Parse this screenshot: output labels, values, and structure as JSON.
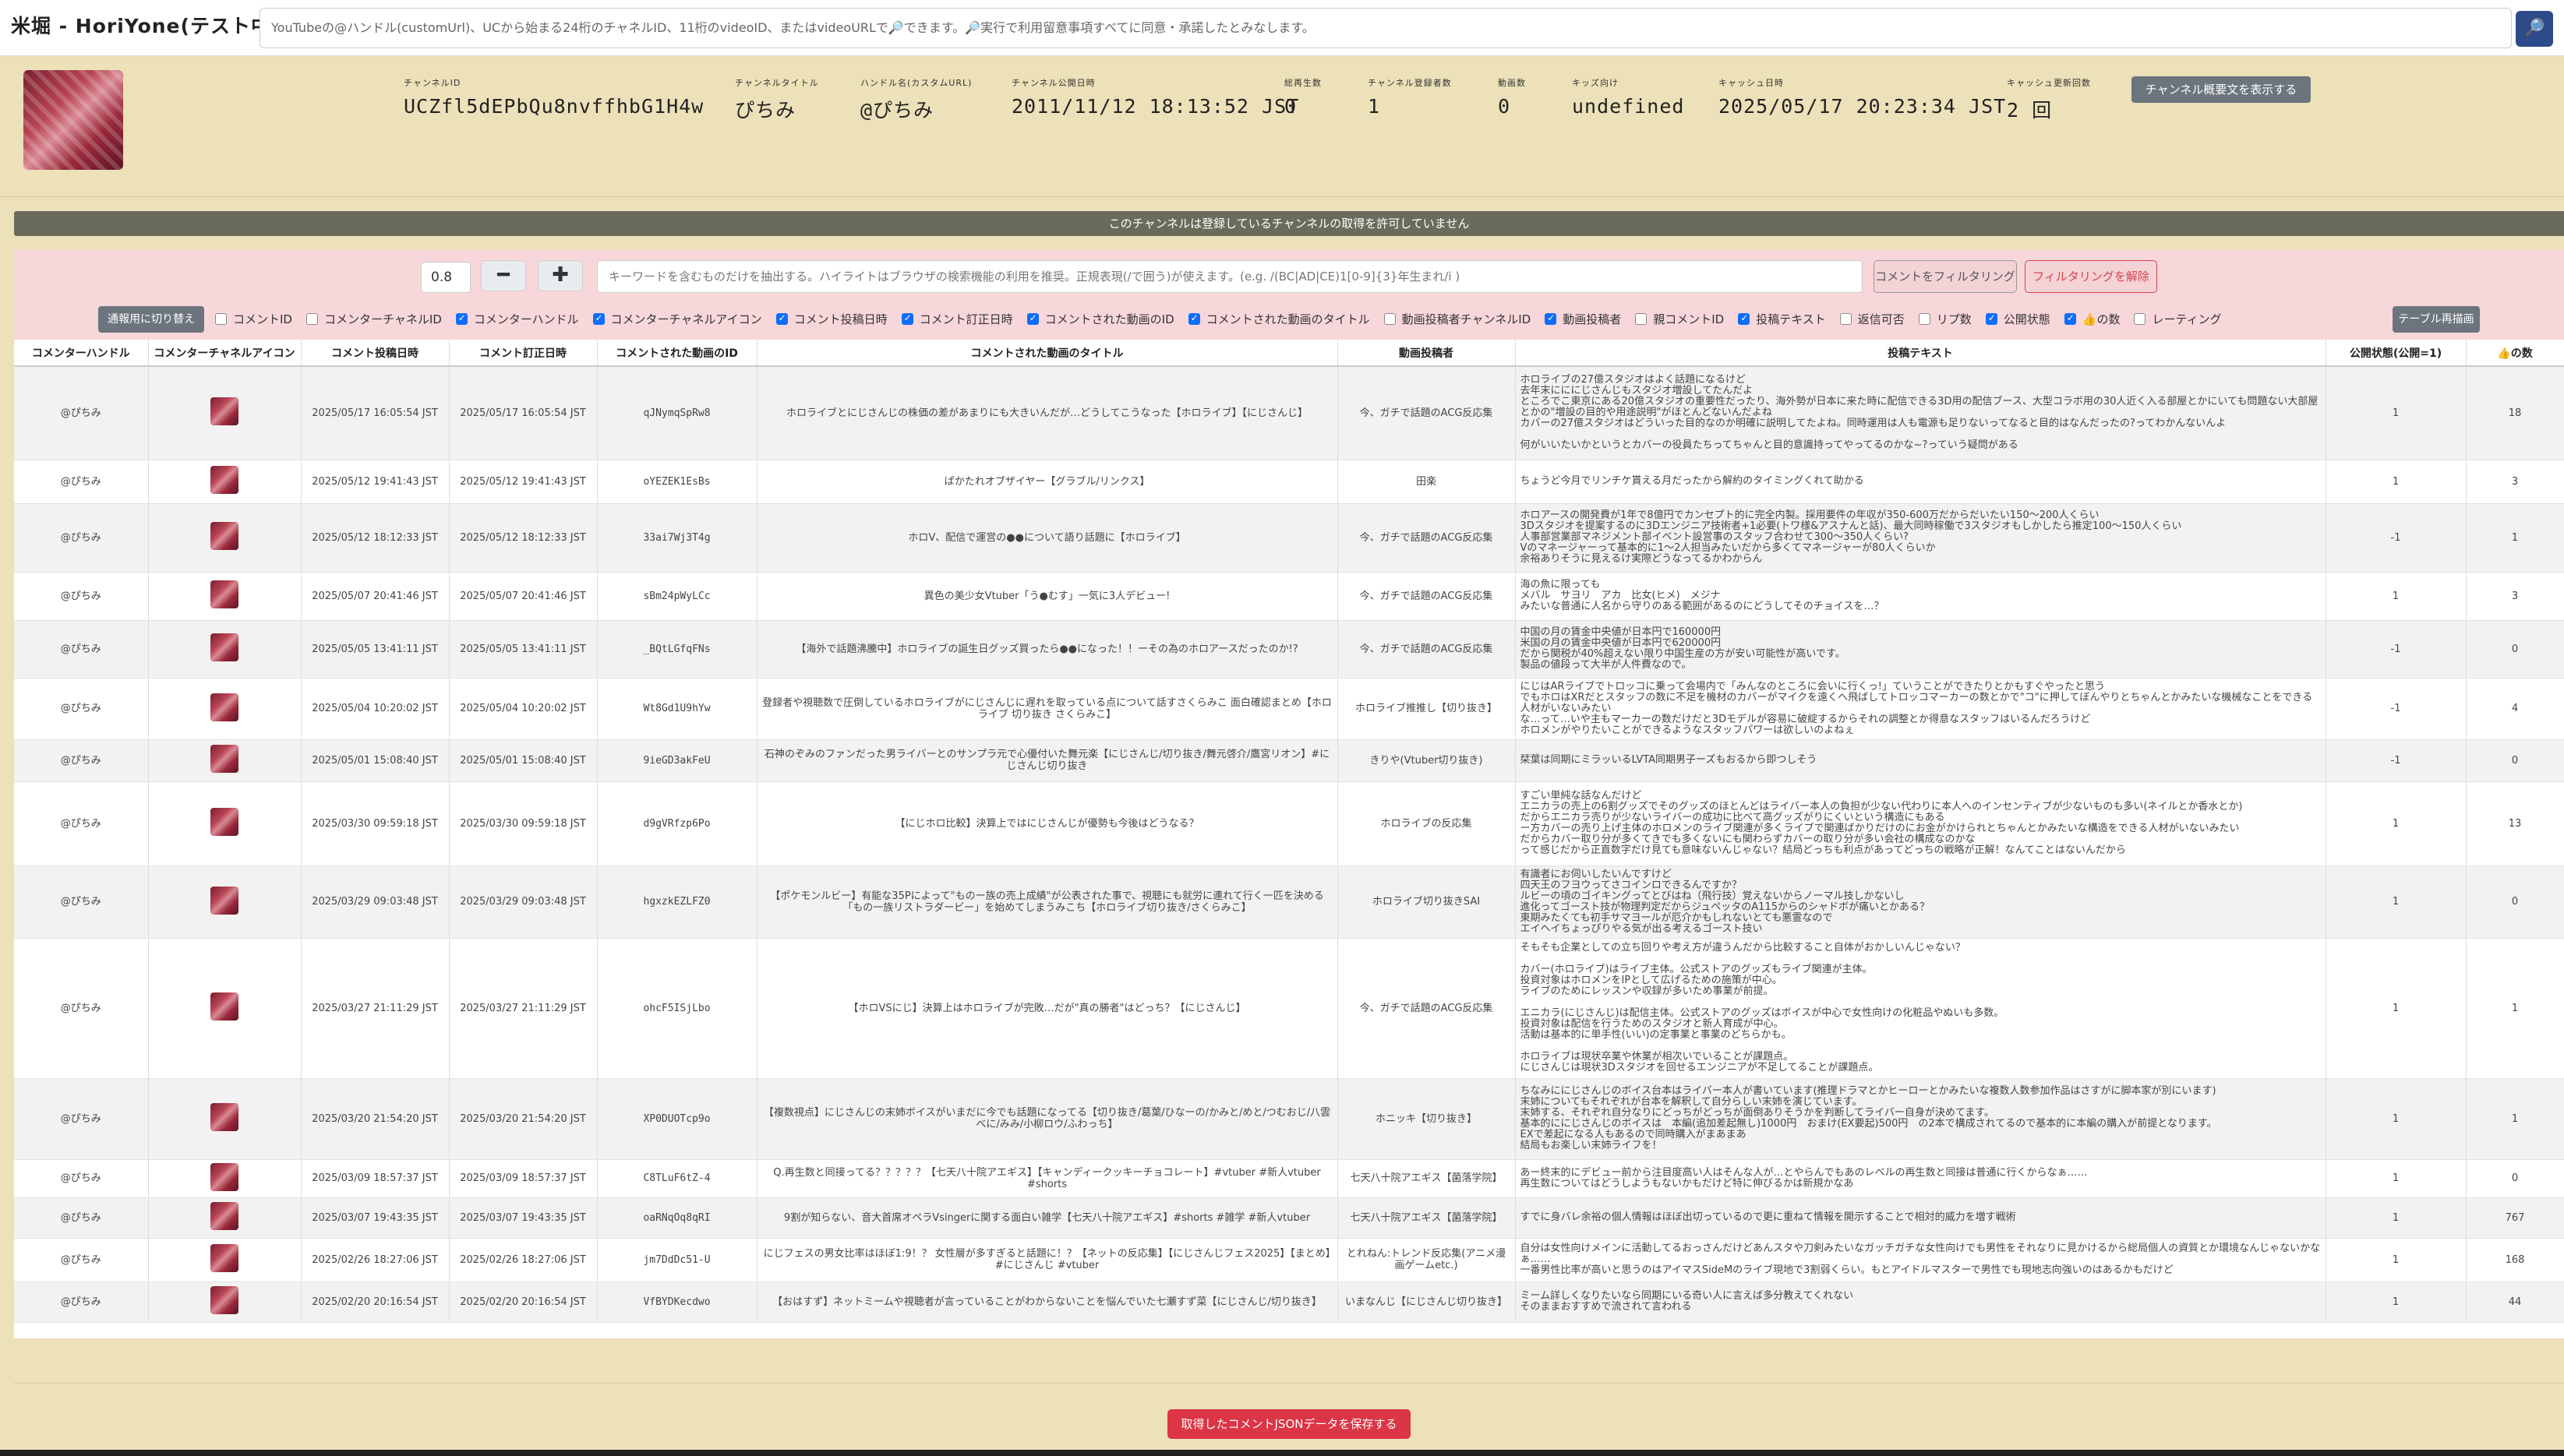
{
  "app": {
    "title": "米堀 - HoriYone(テスト中)"
  },
  "search": {
    "placeholder": "YouTubeの@ハンドル(customUrl)、UCから始まる24桁のチャネルID、11桁のvideoID、またはvideoURLで🔎できます。🔎実行で利用留意事項すべてに同意・承諾したとみなします。",
    "button_icon": "🔎"
  },
  "channel": {
    "fields": [
      {
        "label": "チャンネルID",
        "value": "UCZfl5dEPbQu8nvffhbG1H4w"
      },
      {
        "label": "チャンネルタイトル",
        "value": "ぴちみ"
      },
      {
        "label": "ハンドル名(カスタムURL)",
        "value": "@ぴちみ"
      },
      {
        "label": "チャンネル公開日時",
        "value": "2011/11/12 18:13:52 JST"
      },
      {
        "label": "総再生数",
        "value": "0"
      },
      {
        "label": "チャンネル登録者数",
        "value": "1"
      },
      {
        "label": "動画数",
        "value": "0"
      },
      {
        "label": "キッズ向け",
        "value": "undefined"
      },
      {
        "label": "キャッシュ日時",
        "value": "2025/05/17 20:23:34 JST"
      },
      {
        "label": "キャッシュ更新回数",
        "value": "2 回"
      }
    ],
    "show_description_label": "チャンネル概要文を表示する",
    "notice": "このチャンネルは登録しているチャンネルの取得を許可していません"
  },
  "filter": {
    "step_value": "0.8",
    "minus_label": "━",
    "plus_label": "✚",
    "keyword_placeholder": "キーワードを含むものだけを抽出する。ハイライトはブラウザの検索機能の利用を推奨。正規表現(/で囲う)が使えます。(e.g. /(BC|AD|CE)1[0-9]{3}年生まれ/i )",
    "filter_button": "コメントをフィルタリング",
    "unfilter_button": "フィルタリングを解除",
    "switch_button": "通報用に切り替え",
    "redraw_button": "テーブル再描画",
    "columns": [
      {
        "label": "コメントID",
        "checked": false
      },
      {
        "label": "コメンターチャネルID",
        "checked": false
      },
      {
        "label": "コメンターハンドル",
        "checked": true
      },
      {
        "label": "コメンターチャネルアイコン",
        "checked": true
      },
      {
        "label": "コメント投稿日時",
        "checked": true
      },
      {
        "label": "コメント訂正日時",
        "checked": true
      },
      {
        "label": "コメントされた動画のID",
        "checked": true
      },
      {
        "label": "コメントされた動画のタイトル",
        "checked": true
      },
      {
        "label": "動画投稿者チャンネルID",
        "checked": false
      },
      {
        "label": "動画投稿者",
        "checked": true
      },
      {
        "label": "親コメントID",
        "checked": false
      },
      {
        "label": "投稿テキスト",
        "checked": true
      },
      {
        "label": "返信可否",
        "checked": false
      },
      {
        "label": "リプ数",
        "checked": false
      },
      {
        "label": "公開状態",
        "checked": true
      },
      {
        "label": "👍の数",
        "checked": true
      },
      {
        "label": "レーティング",
        "checked": false
      }
    ]
  },
  "table": {
    "headers": [
      "コメンターハンドル",
      "コメンターチャネルアイコン",
      "コメント投稿日時",
      "コメント訂正日時",
      "コメントされた動画のID",
      "コメントされた動画のタイトル",
      "動画投稿者",
      "投稿テキスト",
      "公開状態(公開=1)",
      "👍の数"
    ],
    "rows": [
      {
        "handle": "@ぴちみ",
        "posted": "2025/05/17 16:05:54 JST",
        "edited": "2025/05/17 16:05:54 JST",
        "video_id": "qJNymqSpRw8",
        "title": "ホロライブとにじさんじの株価の差があまりにも大きいんだが…どうしてこうなった【ホロライブ】【にじさんじ】",
        "uploader": "今、ガチで話題のACG反応集",
        "text": "ホロライブの27億スタジオはよく話題になるけど\n去年末にににじさんじもスタジオ増設してたんだよ\nところでこ東京にある20億スタジオの重要性だったり、海外勢が日本に来た時に配信できる3D用の配信ブース、大型コラボ用の30人近く入る部屋とかにいても問題ない大部屋とかの\"増設の目的や用途説明\"がほとんどないんだよね\nカバーの27億スタジオはどういった目的なのか明確に説明してたよね。同時運用は人も電源も足りないってなると目的はなんだったの?ってわかんないんよ\n\n何がいいたいかというとカバーの役員たちってちゃんと目的意識持ってやってるのかな~?っていう疑問がある",
        "status": "1",
        "likes": "18",
        "h": 120
      },
      {
        "handle": "@ぴちみ",
        "posted": "2025/05/12 19:41:43 JST",
        "edited": "2025/05/12 19:41:43 JST",
        "video_id": "oYEZEK1EsBs",
        "title": "ぱかたれオブザイヤー【グラブル/リンクス】",
        "uploader": "田楽",
        "text": "ちょうど今月でリンチケ貰える月だったから解約のタイミングくれて助かる",
        "status": "1",
        "likes": "3",
        "h": 56
      },
      {
        "handle": "@ぴちみ",
        "posted": "2025/05/12 18:12:33 JST",
        "edited": "2025/05/12 18:12:33 JST",
        "video_id": "33ai7Wj3T4g",
        "title": "ホロV、配信で運営の●●について語り話題に【ホロライブ】",
        "uploader": "今、ガチで話題のACG反応集",
        "text": "ホロアースの開発費が1年で8億円でカンセプト的に完全内製。採用要件の年収が350-600万だからだいたい150～200人くらい\n3Dスタジオを提案するのに3Dエンジニア技術者+1必要(トワ様&アスナんと話)、最大同時稼働で3スタジオもしかしたら推定100～150人くらい\n人事部営業部マネジメント部イベント設営事のスタッフ合わせて300～350人くらい?\nVのマネージャーって基本的に1～2人担当みたいだから多くてマネージャーが80人くらいか\n余裕ありそうに見えるけ実際どうなってるかわからん",
        "status": "-1",
        "likes": "1",
        "h": 88
      },
      {
        "handle": "@ぴちみ",
        "posted": "2025/05/07 20:41:46 JST",
        "edited": "2025/05/07 20:41:46 JST",
        "video_id": "sBm24pWyLCc",
        "title": "異色の美少女Vtuber「う●むす」一気に3人デビュー!",
        "uploader": "今、ガチで話題のACG反応集",
        "text": "海の魚に限っても\nメバル　サヨリ　アカ　比女(ヒメ)　メジナ\nみたいな普通に人名から守りのある範囲があるのにどうしてそのチョイスを…？",
        "status": "1",
        "likes": "3",
        "h": 62
      },
      {
        "handle": "@ぴちみ",
        "posted": "2025/05/05 13:41:11 JST",
        "edited": "2025/05/05 13:41:11 JST",
        "video_id": "_BQtLGfqFNs",
        "title": "【海外で話題沸騰中】ホロライブの誕生日グッズ買ったら●●になった！！ーその為のホロアースだったのか!?",
        "uploader": "今、ガチで話題のACG反応集",
        "text": "中国の月の賃金中央値が日本円で160000円\n米国の月の賃金中央値が日本円で620000円\nだから関税が40%超えない限り中国生産の方が安い可能性が高いです。\n製品の値段って大半が人件費なので。",
        "status": "-1",
        "likes": "0",
        "h": 74
      },
      {
        "handle": "@ぴちみ",
        "posted": "2025/05/04 10:20:02 JST",
        "edited": "2025/05/04 10:20:02 JST",
        "video_id": "Wt8Gd1U9hYw",
        "title": "登録者や視聴数で圧倒しているホロライブがにじさんじに遅れを取っている点について話すさくらみこ 面白確認まとめ【ホロライブ 切り抜き さくらみこ】",
        "uploader": "ホロライブ推推し【切り抜き】",
        "text": "にじはARライブでトロッコに乗って会場内で「みんなのところに会いに行くっ!」ていうことができたりとかもすぐやったと思う\nでもホロはXRだとスタッフの数に不足を機材のカバーがマイクを遠くへ飛ばしてトロッコマーカーの数とかで\"コ\"に押してぼんやりとちゃんとかみたいな機械なことをできる人材がいないみたい\nな…って…いや主もマーカーの数だけだと3Dモデルが容易に破綻するからそれの調整とか得意なスタッフはいるんだろうけど\nホロメンがやりたいことができるようなスタッフパワーは欲しいのよねぇ",
        "status": "-1",
        "likes": "4",
        "h": 76
      },
      {
        "handle": "@ぴちみ",
        "posted": "2025/05/01 15:08:40 JST",
        "edited": "2025/05/01 15:08:40 JST",
        "video_id": "9ieGD3akFeU",
        "title": "石神のぞみのファンだった男ライバーとのサンプラ元で心優付いた舞元楽【にじさんじ/切り抜き/舞元啓介/鷹宮リオン】#にじさんじ切り抜き",
        "uploader": "きりや(Vtuber切り抜き)",
        "text": "栞葉は同期にミラッいるLVTA同期男子ーズもおるから即つしそう",
        "status": "-1",
        "likes": "0",
        "h": 54
      },
      {
        "handle": "@ぴちみ",
        "posted": "2025/03/30 09:59:18 JST",
        "edited": "2025/03/30 09:59:18 JST",
        "video_id": "d9gVRfzp6Po",
        "title": "【にじホロ比較】決算上ではにじさんじが優勢も今後はどうなる？",
        "uploader": "ホロライブの反応集",
        "text": "すごい単純な話なんだけど\nエニカラの売上の6割グッズでそのグッズのほとんどはライバー本人の負担が少ない代わりに本人へのインセンティブが少ないものも多い(ネイルとか香水とか)\nだからエニカラ売りが少ないライバーの成功に比べて高グッズがりにくいという構造にもある\nー方カバーの売り上げ主体のホロメンのライブ関連が多くライブで関連ばかりだけのにお金がかけられとちゃんとかみたいな構造をできる人材がいないみたい\nだからカバー取り分が多くてきでも多くないにも関わらずカバーの取り分が多い会社の構成なのかな\nって感じだから正直数字だけ見ても意味ないんじゃない？結局どっちも利点があってどっちの戦略が正解！なんてことはないんだから",
        "status": "1",
        "likes": "13",
        "h": 108
      },
      {
        "handle": "@ぴちみ",
        "posted": "2025/03/29 09:03:48 JST",
        "edited": "2025/03/29 09:03:48 JST",
        "video_id": "hgxzkEZLFZ0",
        "title": "【ポケモンルビー】有能な35Pによって\"ものー族の売上成績\"が公表された事で、視聴にも就労に連れて行く一匹を決める「もの一族リストラダービー」を始めてしまうみこち【ホロライブ切り抜き/さくらみこ】",
        "uploader": "ホロライブ切り抜きSAI",
        "text": "有識者にお伺いしたいんですけど\n四天王のフヨウってさコインロできるんですか？\nルビーの頃のゴイキングってとびはね（飛行技）覚えないからノーマル技しかないし\n進化ってゴースト技が物理判定だからジュペッタのA115からのシャドボが痛いとかある？\n東期みたくても初手サマヨールが厄介かもしれないとても悪霊なので\nエイヘイちょっぴりやる気が出る考えるゴースト技い",
        "status": "1",
        "likes": "0",
        "h": 86
      },
      {
        "handle": "@ぴちみ",
        "posted": "2025/03/27 21:11:29 JST",
        "edited": "2025/03/27 21:11:29 JST",
        "video_id": "ohcF5ISjLbo",
        "title": "【ホロVSにじ】決算上はホロライブが完敗…だが\"真の勝者\"はどっち？【にじさんじ】",
        "uploader": "今、ガチで話題のACG反応集",
        "text": "そもそも企業としての立ち回りや考え方が違うんだから比較すること自体がおかしいんじゃない？\n\nカバー(ホロライブ)はライブ主体。公式ストアのグッズもライブ関連が主体。\n投資対象はホロメンをIPとして広げるための施策が中心。\nライブのためにレッスンや収録が多いため事業が前提。\n\nエニカラ(にじさんじ)は配信主体。公式ストアのグッズはボイスが中心で女性向けの化粧品やぬいも多数。\n投資対象は配信を行うためのスタジオと新人育成が中心。\n活動は基本的に単手性(いい)の定事業と事業のどちらかも。\n\nホロライブは現状卒業や休業が相次いでいることが課題点。\nにじさんじは現状3Dスタジオを回せるエンジニアが不足してることが課題点。",
        "status": "1",
        "likes": "1",
        "h": 180
      },
      {
        "handle": "@ぴちみ",
        "posted": "2025/03/20 21:54:20 JST",
        "edited": "2025/03/20 21:54:20 JST",
        "video_id": "XP0DUOTcp9o",
        "title": "【複数視点】にじさんじの末姉ボイスがいまだに今でも話題になってる【切り抜き/葛葉/ひなーの/かみと/めと/つむおじ/八雲べに/みみ/小柳ロウ/ふわっち】",
        "uploader": "ホニッキ【切り抜き】",
        "text": "ちなみににじさんじのボイス台本はライバー本人が書いています(推理ドラマとかヒーローとかみたいな複数人数参加作品はさすがに脚本家が別にいます)\n末姉についてもそれぞれが台本を解釈して自分らしい末姉を演じています。\n末姉する、それぞれ自分なりにどっちがどっちが面倒ありそうかを判断してライバー自身が決めてます。\n基本的ににじさんじのボイスは　本編(追加差起無し)1000円　おまけ(EX要起)500円　の2本で構成されてるので基本的に本編の購入が前提となります。\nEXで差起になる人もあるので同時購入がまあまあ\n結局もお楽しい末姉ライフを！",
        "status": "1",
        "likes": "1",
        "h": 104
      },
      {
        "handle": "@ぴちみ",
        "posted": "2025/03/09 18:57:37 JST",
        "edited": "2025/03/09 18:57:37 JST",
        "video_id": "C8TLuF6tZ-4",
        "title": "Q.再生数と同接ってる？？？？？【七天八十院アエギス】【キャンディークッキーチョコレート】#vtuber #新人vtuber #shorts",
        "uploader": "七天八十院アエギス【菌落学院】",
        "text": "あー終末的にデビュー前から注目度高い人はそんな人が…とやらんでもあのレベルの再生数と同接は普通に行くからなぁ……\n再生数についてはどうしようもないかもだけど特に伸びるかは新規かなあ",
        "status": "1",
        "likes": "0",
        "h": 48
      },
      {
        "handle": "@ぴちみ",
        "posted": "2025/03/07 19:43:35 JST",
        "edited": "2025/03/07 19:43:35 JST",
        "video_id": "oaRNqOq8qRI",
        "title": "9割が知らない、音大首席オペラVsingerに関する面白い雑学【七天八十院アエギス】#shorts #雑学 #新人vtuber",
        "uploader": "七天八十院アエギス【菌落学院】",
        "text": "すでに身バレ余裕の個人情報はほぼ出切っているので更に重ねて情報を開示することで相対的威力を増す戦術",
        "status": "1",
        "likes": "767",
        "h": 52
      },
      {
        "handle": "@ぴちみ",
        "posted": "2025/02/26 18:27:06 JST",
        "edited": "2025/02/26 18:27:06 JST",
        "video_id": "jm7DdDc51-U",
        "title": "にじフェスの男女比率はほぼ1:9！？ 女性層が多すぎると話題に！？【ネットの反応集】【にじさんじフェス2025】【まとめ】#にじさんじ #vtuber",
        "uploader": "とれねん:トレンド反応集(アニメ漫画ゲームetc.)",
        "text": "自分は女性向けメインに活動してるおっさんだけどあんスタや刀剣みたいなガッチガチな女性向けでも男性をそれなりに見かけるから総局個人の資質とか環境なんじゃないかなぁ……\n一番男性比率が高いと思うのはアイマスSideMのライブ現地で3割弱くらい。もとアイドルマスターで男性でも現地志向強いのはあるかもだけど",
        "status": "1",
        "likes": "168",
        "h": 56
      },
      {
        "handle": "@ぴちみ",
        "posted": "2025/02/20 20:16:54 JST",
        "edited": "2025/02/20 20:16:54 JST",
        "video_id": "VfBYDKecdwo",
        "title": "【おはすず】ネットミームや視聴者が言っていることがわからないことを悩んでいた七瀬すず菜【にじさんじ/切り抜き】",
        "uploader": "いまなんじ【にじさんじ切り抜き】",
        "text": "ミーム詳しくなりたいなら同期にいる奇い人に言えば多分教えてくれない\nそのままおすすめで流されて言われる",
        "status": "1",
        "likes": "44",
        "h": 52
      }
    ]
  },
  "footer": {
    "save_button": "取得したコメントJSONデータを保存する"
  }
}
